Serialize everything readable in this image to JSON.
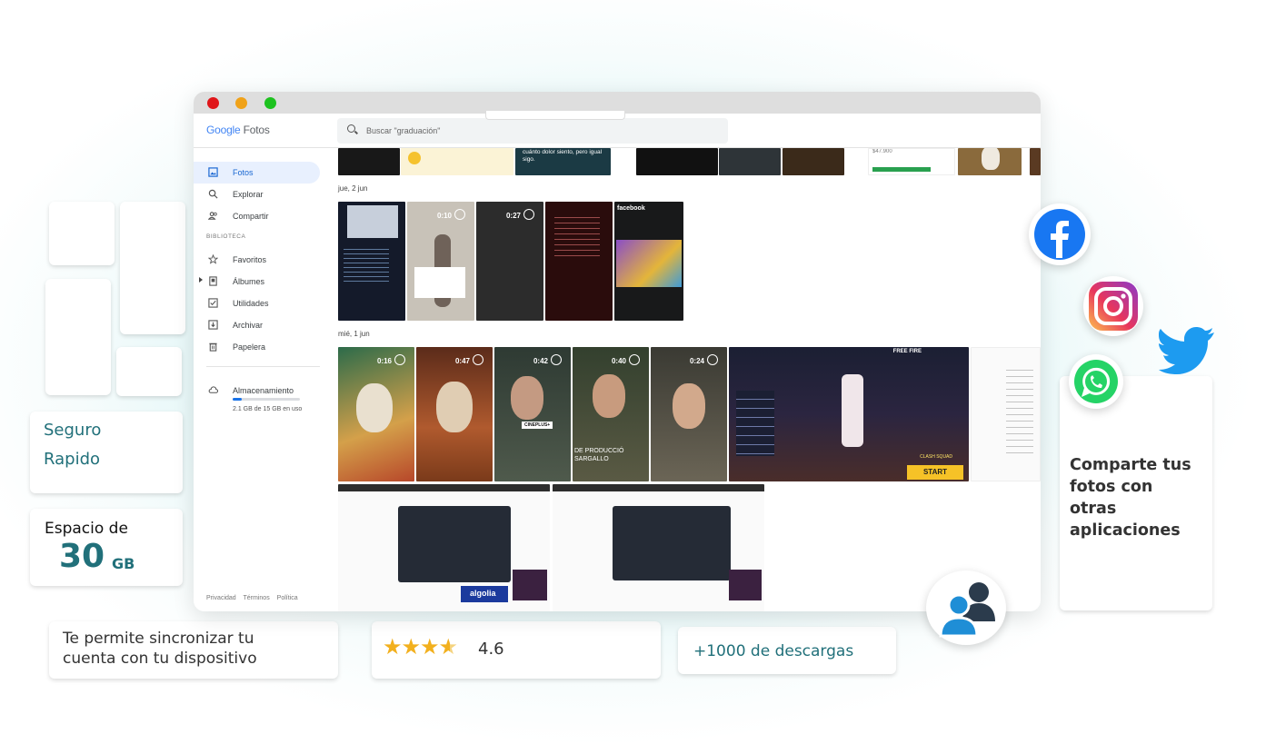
{
  "app": {
    "logo_google": "Google",
    "logo_product": "Fotos",
    "search_placeholder": "Buscar \"graduación\""
  },
  "sidebar": {
    "items": [
      {
        "label": "Fotos",
        "icon": "photo-icon",
        "selected": true
      },
      {
        "label": "Explorar",
        "icon": "search-icon"
      },
      {
        "label": "Compartir",
        "icon": "people-icon"
      }
    ],
    "library_title": "BIBLIOTECA",
    "library": [
      {
        "label": "Favoritos",
        "icon": "star-icon"
      },
      {
        "label": "Álbumes",
        "icon": "album-icon"
      },
      {
        "label": "Utilidades",
        "icon": "utilities-icon"
      },
      {
        "label": "Archivar",
        "icon": "archive-icon"
      },
      {
        "label": "Papelera",
        "icon": "trash-icon"
      }
    ],
    "storage": {
      "label": "Almacenamiento",
      "usage": "2.1 GB de 15 GB en uso",
      "fraction": 0.14
    },
    "footer": [
      "Privacidad",
      "Términos",
      "Política"
    ]
  },
  "main": {
    "top_fragments": {
      "meme_text": "cuánto dolor siento, pero igual sigo.",
      "price": "$47.900"
    },
    "sections": [
      {
        "date": "jue, 2 jun",
        "durations": [
          "0:10",
          "0:27"
        ]
      },
      {
        "date": "mié, 1 jun",
        "durations": [
          "0:16",
          "0:47",
          "0:42",
          "0:40",
          "0:24"
        ]
      }
    ],
    "overlay_texts": {
      "facebook": "facebook",
      "cineplus": "CINEPLUS+",
      "producer": "DE PRODUCCIÓ SARGALLO",
      "game_title": "FREE FIRE",
      "game_start": "START",
      "game_squad": "CLASH SQUAD",
      "algolia": "algolia"
    }
  },
  "promo": {
    "feature_a": "Seguro",
    "feature_b": "Rapido",
    "space_label": "Espacio de",
    "space_value": "30",
    "space_unit": "GB",
    "sync_text": "Te permite sincronizar tu cuenta con tu dispositivo",
    "rating": 4.6,
    "rating_text": "4.6",
    "downloads": "+1000 de descargas",
    "share_text": "Comparte tus fotos con otras aplicaciones"
  },
  "colors": {
    "accent": "#21707a",
    "google_blue": "#4285f4",
    "selected_nav": "#e8f0fe",
    "star": "#f2b01e"
  },
  "social_icons": [
    "facebook-icon",
    "instagram-icon",
    "twitter-icon",
    "whatsapp-icon",
    "users-icon"
  ]
}
